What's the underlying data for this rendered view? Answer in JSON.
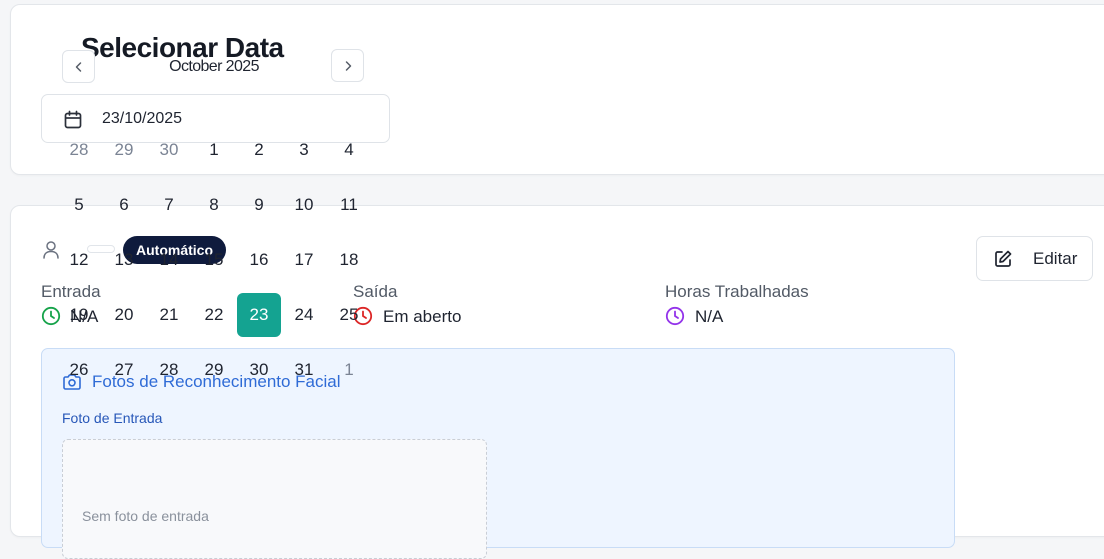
{
  "header": {
    "title": "Selecionar Data",
    "month_label": "October 2025"
  },
  "date_field": {
    "value": "23/10/2025",
    "icon": "calendar-icon"
  },
  "calendar": {
    "selected_day": "23",
    "selected_color": "#14a391",
    "weeks": [
      [
        {
          "d": "28",
          "muted": true
        },
        {
          "d": "29",
          "muted": true
        },
        {
          "d": "30",
          "muted": true
        },
        {
          "d": "1"
        },
        {
          "d": "2"
        },
        {
          "d": "3"
        },
        {
          "d": "4"
        }
      ],
      [
        {
          "d": "5"
        },
        {
          "d": "6"
        },
        {
          "d": "7"
        },
        {
          "d": "8"
        },
        {
          "d": "9"
        },
        {
          "d": "10"
        },
        {
          "d": "11"
        }
      ],
      [
        {
          "d": "12"
        },
        {
          "d": "13"
        },
        {
          "d": "14"
        },
        {
          "d": "15"
        },
        {
          "d": "16"
        },
        {
          "d": "17"
        },
        {
          "d": "18"
        }
      ],
      [
        {
          "d": "19"
        },
        {
          "d": "20"
        },
        {
          "d": "21"
        },
        {
          "d": "22"
        },
        {
          "d": "23",
          "selected": true
        },
        {
          "d": "24"
        },
        {
          "d": "25"
        }
      ],
      [
        {
          "d": "26"
        },
        {
          "d": "27"
        },
        {
          "d": "28"
        },
        {
          "d": "29"
        },
        {
          "d": "30"
        },
        {
          "d": "31"
        },
        {
          "d": "1",
          "muted": true
        }
      ]
    ]
  },
  "record": {
    "badge": "Automático",
    "edit_label": "Editar",
    "entrada": {
      "label": "Entrada",
      "value": "N/A",
      "color": "#16a34a"
    },
    "saida": {
      "label": "Saída",
      "value": "Em aberto",
      "color": "#dc2626"
    },
    "horas": {
      "label": "Horas Trabalhadas",
      "value": "N/A",
      "color": "#9333ea"
    }
  },
  "photos": {
    "title": "Fotos de Reconhecimento Facial",
    "entry_label": "Foto de Entrada",
    "placeholder": "Sem foto de entrada"
  }
}
